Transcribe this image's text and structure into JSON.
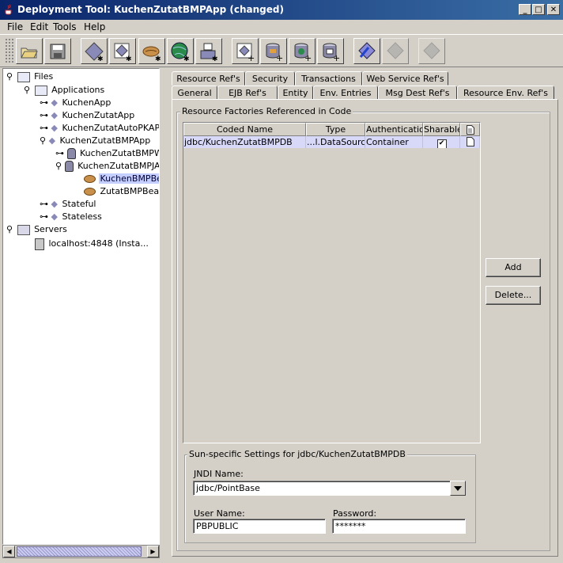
{
  "window": {
    "title": "Deployment Tool: KuchenZutatBMPApp (changed)",
    "controls": [
      "minimize",
      "maximize",
      "close"
    ]
  },
  "menu": [
    {
      "label": "File"
    },
    {
      "label": "Edit"
    },
    {
      "label": "Tools"
    },
    {
      "label": "Help"
    }
  ],
  "toolbar": {
    "buttons": [
      "open-icon",
      "save-icon",
      "new-ejb-icon",
      "new-web-component-icon",
      "new-bean-icon",
      "new-application-client-icon",
      "new-connector-icon",
      "add-server-icon",
      "deploy-icon",
      "deploy-icon-2",
      "undeploy-icon",
      "verify-icon",
      "update-icon",
      "update-disabled-icon"
    ]
  },
  "tree": {
    "files": "Files",
    "applications": "Applications",
    "apps": [
      "KuchenApp",
      "KuchenZutatApp",
      "KuchenZutatAutoPKAPP",
      "KuchenZutatBMPApp"
    ],
    "jar1": "KuchenZutatBMPWA",
    "jar2": "KuchenZutatBMPJA",
    "bean_selected": "KuchenBMPBea",
    "bean2": "ZutatBMPBean",
    "stateful": "Stateful",
    "stateless": "Stateless",
    "servers": "Servers",
    "server1": "localhost:4848 (Insta..."
  },
  "tabs": {
    "row_top": [
      "Resource Ref's",
      "Security",
      "Transactions",
      "Web Service Ref's"
    ],
    "row_bottom": [
      "General",
      "EJB Ref's",
      "Entity",
      "Env. Entries",
      "Msg Dest Ref's",
      "Resource Env. Ref's"
    ],
    "active": "Resource Ref's"
  },
  "factories": {
    "group_title": "Resource Factories Referenced in Code",
    "columns": [
      "Coded Name",
      "Type",
      "Authentication",
      "Sharable"
    ],
    "rows": [
      {
        "coded_name": "jdbc/KuchenZutatBMPDB",
        "type": "...l.DataSource",
        "authentication": "Container",
        "sharable": true
      }
    ],
    "add_label": "Add",
    "delete_label": "Delete..."
  },
  "sun_settings": {
    "group_title": "Sun-specific Settings for jdbc/KuchenZutatBMPDB",
    "jndi_label": "JNDI Name:",
    "jndi_value": "jdbc/PointBase",
    "user_label": "User Name:",
    "user_value": "PBPUBLIC",
    "password_label": "Password:",
    "password_value": "*******"
  },
  "colors": {
    "title_bar": "#0a246a",
    "selection": "#c4cfff",
    "background": "#d4d0c8"
  }
}
